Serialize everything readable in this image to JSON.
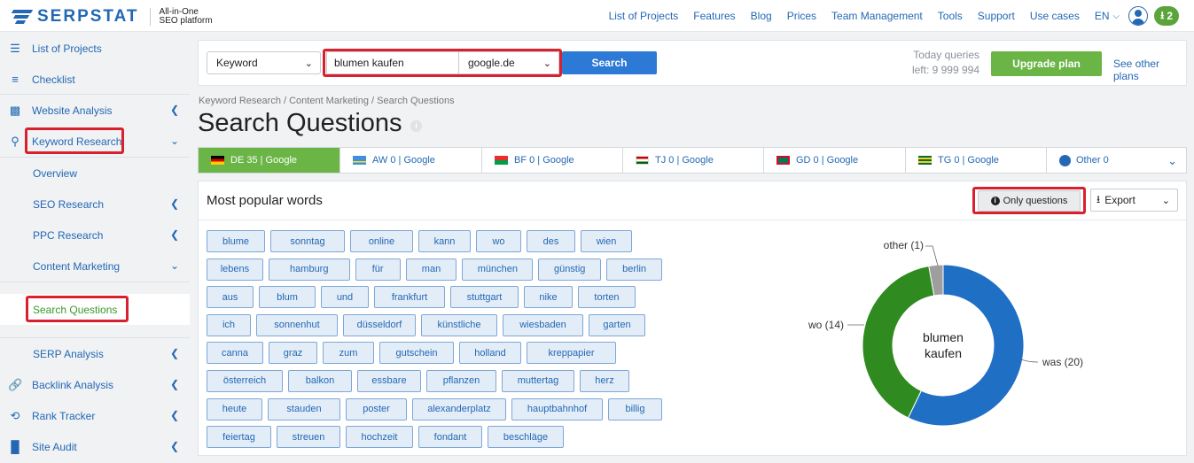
{
  "header": {
    "brand": "SERPSTAT",
    "tagline_1": "All-in-One",
    "tagline_2": "SEO platform",
    "nav": [
      "List of Projects",
      "Features",
      "Blog",
      "Prices",
      "Team Management",
      "Tools",
      "Support",
      "Use cases"
    ],
    "language": "EN",
    "downloads_count": "2"
  },
  "sidebar": {
    "items": [
      {
        "label": "List of Projects",
        "icon": "list-icon"
      },
      {
        "label": "Checklist",
        "icon": "checklist-icon"
      },
      {
        "label": "Website Analysis",
        "icon": "bar-chart-icon"
      },
      {
        "label": "Keyword Research",
        "icon": "key-icon"
      },
      {
        "label": "Overview"
      },
      {
        "label": "SEO Research"
      },
      {
        "label": "PPC Research"
      },
      {
        "label": "Content Marketing"
      },
      {
        "label": "Search Questions"
      },
      {
        "label": "SERP Analysis"
      },
      {
        "label": "Backlink Analysis",
        "icon": "link-icon"
      },
      {
        "label": "Rank Tracker",
        "icon": "history-icon"
      },
      {
        "label": "Site Audit",
        "icon": "sitemap-icon"
      }
    ]
  },
  "search": {
    "type_select": "Keyword",
    "query": "blumen kaufen",
    "engine": "google.de",
    "button": "Search",
    "queries_line1": "Today queries",
    "queries_line2": "left: 9 999 994",
    "upgrade": "Upgrade plan",
    "see_plans": "See other plans"
  },
  "breadcrumb": "Keyword Research / Content Marketing / Search Questions",
  "page_title": "Search Questions",
  "tabs": [
    {
      "label": "DE 35 | Google",
      "flag": "de",
      "active": true
    },
    {
      "label": "AW 0 | Google",
      "flag": "aw"
    },
    {
      "label": "BF 0 | Google",
      "flag": "bf"
    },
    {
      "label": "TJ 0 | Google",
      "flag": "tj"
    },
    {
      "label": "GD 0 | Google",
      "flag": "gd"
    },
    {
      "label": "TG 0 | Google",
      "flag": "tg"
    },
    {
      "label": "Other 0",
      "flag": "globe"
    }
  ],
  "card": {
    "title": "Most popular words",
    "only_questions": "Only questions",
    "export": "Export"
  },
  "words": [
    [
      "blume",
      "sonntag",
      "online",
      "kann",
      "wo",
      "des",
      "wien"
    ],
    [
      "lebens",
      "hamburg",
      "für",
      "man",
      "münchen",
      "günstig",
      "berlin"
    ],
    [
      "aus",
      "blum",
      "und",
      "frankfurt",
      "stuttgart",
      "nike",
      "torten"
    ],
    [
      "ich",
      "sonnenhut",
      "düsseldorf",
      "künstliche",
      "wiesbaden",
      "garten"
    ],
    [
      "canna",
      "graz",
      "zum",
      "gutschein",
      "holland",
      "kreppapier"
    ],
    [
      "österreich",
      "balkon",
      "essbare",
      "pflanzen",
      "muttertag",
      "herz"
    ],
    [
      "heute",
      "stauden",
      "poster",
      "alexanderplatz",
      "hauptbahnhof",
      "billig"
    ],
    [
      "feiertag",
      "streuen",
      "hochzeit",
      "fondant",
      "beschläge"
    ]
  ],
  "chart_data": {
    "type": "pie",
    "center_label_1": "blumen",
    "center_label_2": "kaufen",
    "slices": [
      {
        "name": "was",
        "value": 20,
        "label": "was (20)",
        "color": "#1f6fc5"
      },
      {
        "name": "wo",
        "value": 14,
        "label": "wo (14)",
        "color": "#2f8a1f"
      },
      {
        "name": "other",
        "value": 1,
        "label": "other (1)",
        "color": "#9e9e9e"
      }
    ]
  }
}
